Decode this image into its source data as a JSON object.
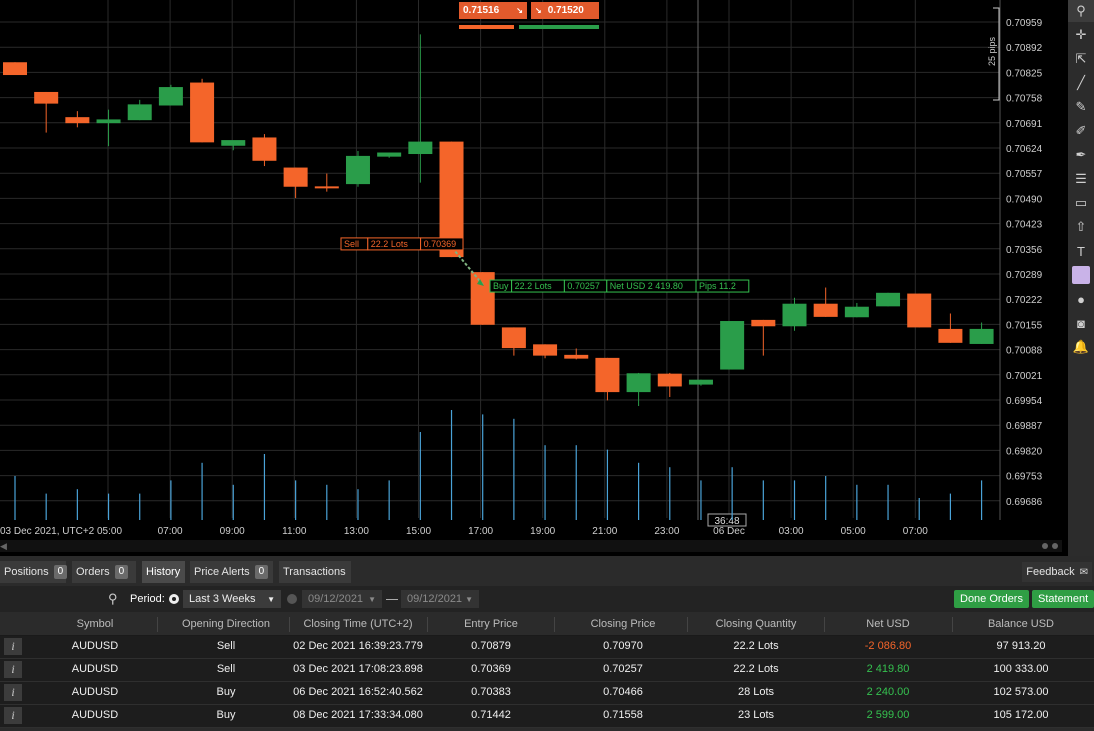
{
  "colors": {
    "bull": "#2a9d4a",
    "bear": "#f4652a",
    "grid": "#2a2a2a",
    "axis_text": "#cfcfcf",
    "volume": "#4aa3d8"
  },
  "quote": {
    "bid": "0.71516",
    "ask": "0.71520"
  },
  "chart_data": {
    "type": "candlestick",
    "y_ticks": [
      "0.70959",
      "0.70892",
      "0.70825",
      "0.70758",
      "0.70691",
      "0.70624",
      "0.70557",
      "0.70490",
      "0.70423",
      "0.70356",
      "0.70289",
      "0.70222",
      "0.70155",
      "0.70088",
      "0.70021",
      "0.69954",
      "0.69887",
      "0.69820",
      "0.69753",
      "0.69686"
    ],
    "x_ticks": [
      "03 Dec 2021, UTC+2 05:00",
      "07:00",
      "09:00",
      "11:00",
      "13:00",
      "15:00",
      "17:00",
      "19:00",
      "21:00",
      "23:00",
      "06 Dec",
      "03:00",
      "05:00",
      "07:00"
    ],
    "crosshair_time": "36:48",
    "range_label": "25 pips",
    "candles": [
      {
        "o": 0.70852,
        "h": 0.70852,
        "l": 0.70818,
        "c": 0.70818
      },
      {
        "o": 0.70773,
        "h": 0.70773,
        "l": 0.70665,
        "c": 0.70742
      },
      {
        "o": 0.70706,
        "h": 0.70722,
        "l": 0.70679,
        "c": 0.7069
      },
      {
        "o": 0.7069,
        "h": 0.70726,
        "l": 0.70629,
        "c": 0.707
      },
      {
        "o": 0.70698,
        "h": 0.70752,
        "l": 0.70698,
        "c": 0.7074
      },
      {
        "o": 0.70737,
        "h": 0.70792,
        "l": 0.70737,
        "c": 0.70786
      },
      {
        "o": 0.70798,
        "h": 0.70808,
        "l": 0.70639,
        "c": 0.70639
      },
      {
        "o": 0.7063,
        "h": 0.70641,
        "l": 0.70618,
        "c": 0.70645
      },
      {
        "o": 0.70652,
        "h": 0.70661,
        "l": 0.70576,
        "c": 0.7059
      },
      {
        "o": 0.70572,
        "h": 0.70572,
        "l": 0.70491,
        "c": 0.70521
      },
      {
        "o": 0.70522,
        "h": 0.70556,
        "l": 0.70508,
        "c": 0.70518
      },
      {
        "o": 0.70528,
        "h": 0.70616,
        "l": 0.70521,
        "c": 0.70603
      },
      {
        "o": 0.70601,
        "h": 0.70612,
        "l": 0.70598,
        "c": 0.70612
      },
      {
        "o": 0.70608,
        "h": 0.70926,
        "l": 0.70532,
        "c": 0.70641
      },
      {
        "o": 0.70641,
        "h": 0.70641,
        "l": 0.70334,
        "c": 0.70334
      },
      {
        "o": 0.70294,
        "h": 0.70294,
        "l": 0.70154,
        "c": 0.70154
      },
      {
        "o": 0.70147,
        "h": 0.70147,
        "l": 0.70072,
        "c": 0.70092
      },
      {
        "o": 0.70102,
        "h": 0.70102,
        "l": 0.70065,
        "c": 0.70072
      },
      {
        "o": 0.70074,
        "h": 0.70091,
        "l": 0.70062,
        "c": 0.70064
      },
      {
        "o": 0.70066,
        "h": 0.70066,
        "l": 0.69953,
        "c": 0.69975
      },
      {
        "o": 0.69975,
        "h": 0.70026,
        "l": 0.69938,
        "c": 0.70025
      },
      {
        "o": 0.70024,
        "h": 0.70026,
        "l": 0.69962,
        "c": 0.6999
      },
      {
        "o": 0.69995,
        "h": 0.70008,
        "l": 0.69992,
        "c": 0.70008
      },
      {
        "o": 0.70035,
        "h": 0.70164,
        "l": 0.70035,
        "c": 0.70164
      },
      {
        "o": 0.70167,
        "h": 0.70167,
        "l": 0.70072,
        "c": 0.7015
      },
      {
        "o": 0.7015,
        "h": 0.70226,
        "l": 0.70138,
        "c": 0.7021
      },
      {
        "o": 0.7021,
        "h": 0.70253,
        "l": 0.70175,
        "c": 0.70175
      },
      {
        "o": 0.70174,
        "h": 0.70212,
        "l": 0.70174,
        "c": 0.70202
      },
      {
        "o": 0.70203,
        "h": 0.70239,
        "l": 0.70203,
        "c": 0.70239
      },
      {
        "o": 0.70237,
        "h": 0.70237,
        "l": 0.70147,
        "c": 0.70147
      },
      {
        "o": 0.70143,
        "h": 0.70184,
        "l": 0.70106,
        "c": 0.70106
      },
      {
        "o": 0.70103,
        "h": 0.7016,
        "l": 0.70103,
        "c": 0.70143
      }
    ],
    "volume": [
      20,
      12,
      14,
      12,
      12,
      18,
      26,
      16,
      30,
      18,
      16,
      14,
      18,
      40,
      50,
      48,
      46,
      34,
      34,
      32,
      26,
      24,
      18,
      24,
      18,
      18,
      20,
      16,
      16,
      10,
      12,
      18
    ],
    "trade_markers": [
      {
        "label": "Sell",
        "lots": "22.2 Lots",
        "price": "0.70369"
      },
      {
        "label": "Buy",
        "lots": "22.2 Lots",
        "price": "0.70257",
        "net": "Net USD 2 419.80",
        "pips": "Pips 11.2"
      }
    ]
  },
  "toolbar_icons": [
    "search-icon",
    "crosshair-icon",
    "cursor-icon",
    "line-icon",
    "pencil-icon",
    "brush-icon",
    "pen-icon",
    "fibonacci-icon",
    "rectangle-icon",
    "arrow-icon",
    "text-icon",
    "color-icon",
    "eraser-icon",
    "camera-icon",
    "bell-icon"
  ],
  "panel": {
    "tabs": [
      {
        "label": "Positions",
        "count": "0"
      },
      {
        "label": "Orders",
        "count": "0"
      },
      {
        "label": "History",
        "count": ""
      },
      {
        "label": "Price Alerts",
        "count": "0"
      },
      {
        "label": "Transactions",
        "count": ""
      }
    ],
    "feedback_label": "Feedback",
    "filter": {
      "period_label": "Period:",
      "period_value": "Last 3 Weeks",
      "from_date": "09/12/2021",
      "to_date": "09/12/2021",
      "done_orders_label": "Done Orders",
      "statement_label": "Statement"
    },
    "columns": [
      "Symbol",
      "Opening Direction",
      "Closing Time (UTC+2)",
      "Entry Price",
      "Closing Price",
      "Closing Quantity",
      "Net USD",
      "Balance USD"
    ],
    "rows": [
      {
        "symbol": "AUDUSD",
        "direction": "Sell",
        "closing_time": "02 Dec 2021 16:39:23.779",
        "entry": "0.70879",
        "closing": "0.70970",
        "qty": "22.2 Lots",
        "net": "-2 086.80",
        "net_color": "#f4652a",
        "balance": "97 913.20"
      },
      {
        "symbol": "AUDUSD",
        "direction": "Sell",
        "closing_time": "03 Dec 2021 17:08:23.898",
        "entry": "0.70369",
        "closing": "0.70257",
        "qty": "22.2 Lots",
        "net": "2 419.80",
        "net_color": "#35c04f",
        "balance": "100 333.00"
      },
      {
        "symbol": "AUDUSD",
        "direction": "Buy",
        "closing_time": "06 Dec 2021 16:52:40.562",
        "entry": "0.70383",
        "closing": "0.70466",
        "qty": "28 Lots",
        "net": "2 240.00",
        "net_color": "#35c04f",
        "balance": "102 573.00"
      },
      {
        "symbol": "AUDUSD",
        "direction": "Buy",
        "closing_time": "08 Dec 2021 17:33:34.080",
        "entry": "0.71442",
        "closing": "0.71558",
        "qty": "23 Lots",
        "net": "2 599.00",
        "net_color": "#35c04f",
        "balance": "105 172.00"
      }
    ]
  }
}
